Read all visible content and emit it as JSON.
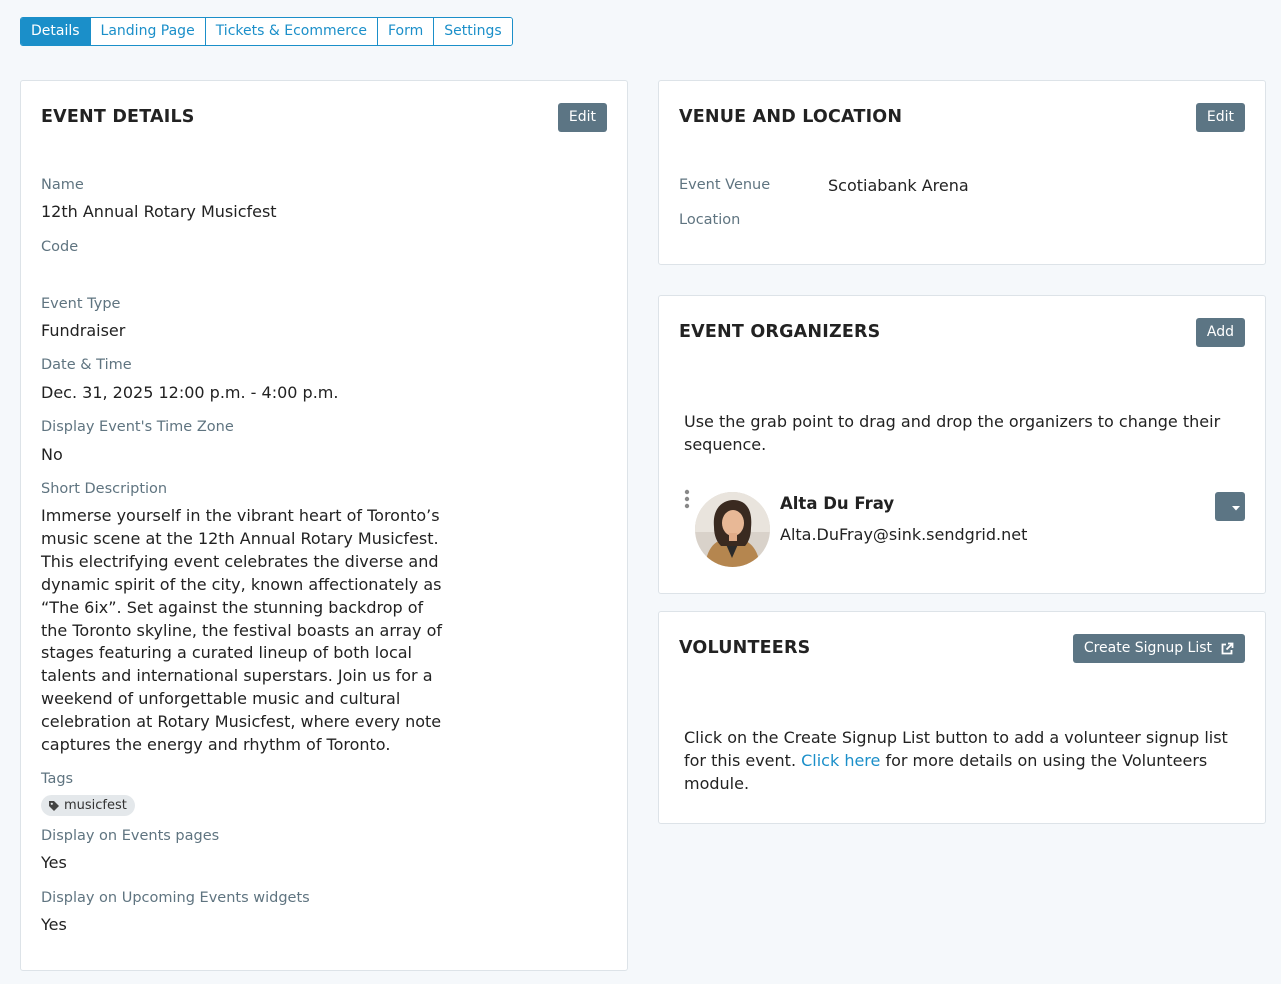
{
  "tabs": [
    {
      "label": "Details"
    },
    {
      "label": "Landing Page"
    },
    {
      "label": "Tickets & Ecommerce"
    },
    {
      "label": "Form"
    },
    {
      "label": "Settings"
    }
  ],
  "event_details": {
    "title": "EVENT DETAILS",
    "edit_label": "Edit",
    "name_label": "Name",
    "name_value": "12th Annual Rotary Musicfest",
    "code_label": "Code",
    "event_type_label": "Event Type",
    "event_type_value": "Fundraiser",
    "datetime_label": "Date & Time",
    "datetime_value": "Dec. 31, 2025 12:00 p.m. - 4:00 p.m.",
    "timezone_label": "Display Event's Time Zone",
    "timezone_value": "No",
    "short_desc_label": "Short Description",
    "short_desc_value": "Immerse yourself in the vibrant heart of Toronto’s music scene at the 12th Annual Rotary Musicfest. This electrifying event celebrates the diverse and dynamic spirit of the city, known affectionately as “The 6ix”. Set against the stunning backdrop of the Toronto skyline, the festival boasts an array of stages featuring a curated lineup of both local talents and international superstars. Join us for a weekend of unforgettable music and cultural celebration at Rotary Musicfest, where every note captures the energy and rhythm of Toronto.",
    "tags_label": "Tags",
    "tag_value": "musicfest",
    "events_pages_label": "Display on Events pages",
    "events_pages_value": "Yes",
    "upcoming_label": "Display on Upcoming Events widgets",
    "upcoming_value": "Yes"
  },
  "venue": {
    "title": "VENUE AND LOCATION",
    "edit_label": "Edit",
    "venue_label": "Event Venue",
    "venue_value": "Scotiabank Arena",
    "location_label": "Location"
  },
  "organizers": {
    "title": "EVENT ORGANIZERS",
    "add_label": "Add",
    "instructions": "Use the grab point to drag and drop the organizers to change their sequence.",
    "items": [
      {
        "name": "Alta Du Fray",
        "email": "Alta.DuFray@sink.sendgrid.net"
      }
    ]
  },
  "volunteers": {
    "title": "VOLUNTEERS",
    "create_label": "Create Signup List",
    "text_before": "Click on the Create Signup List button to add a volunteer signup list for this event. ",
    "link_text": "Click here",
    "text_after": " for more details on using the Volunteers module."
  },
  "colors": {
    "accent": "#1b8fc9",
    "button": "#5c7584",
    "label": "#5f7480"
  }
}
